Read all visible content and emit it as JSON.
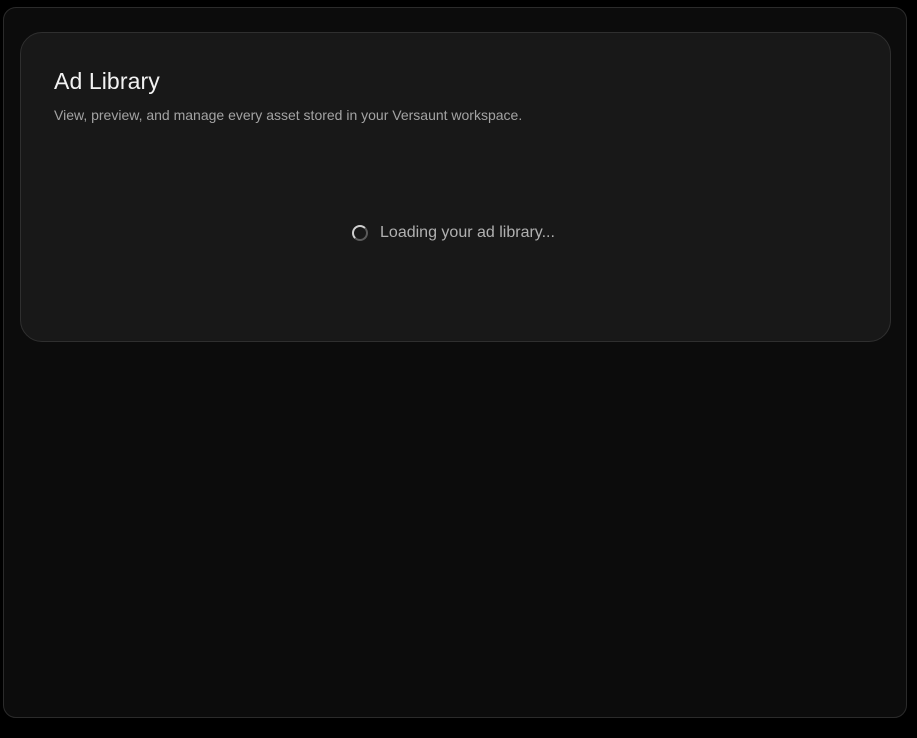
{
  "header": {
    "title": "Ad Library",
    "subtitle": "View, preview, and manage every asset stored in your Versaunt workspace."
  },
  "loading": {
    "icon": "spinner-icon",
    "text": "Loading your ad library..."
  },
  "colors": {
    "page_background": "#000000",
    "frame_background": "#0c0c0c",
    "card_background": "#181818",
    "title_text": "#f2f2f2",
    "muted_text": "#a3a3a3"
  }
}
